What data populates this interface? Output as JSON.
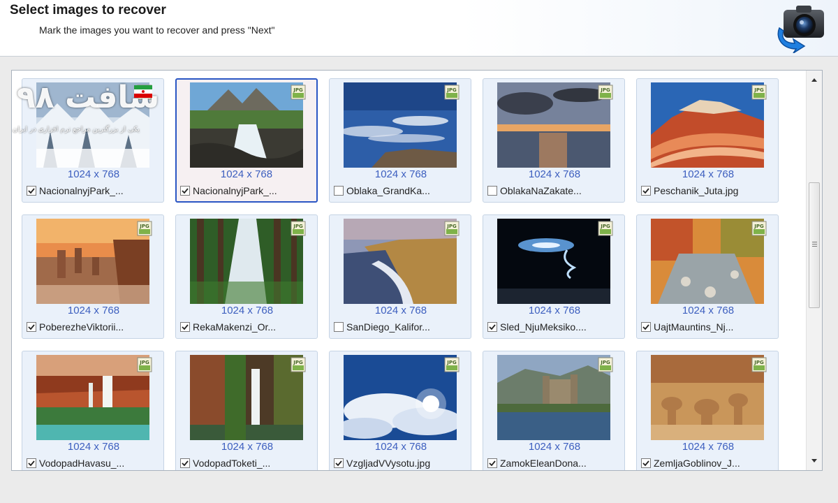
{
  "header": {
    "title": "Select images to recover",
    "subtitle": "Mark the images you want to recover and press \"Next\""
  },
  "watermark": {
    "text": "سافت ۹۸",
    "subtext": "یکی از بزرگترین مراجع نرم افزاری در ایران"
  },
  "icons": {
    "camera": "camera-recover-icon",
    "badge": "jpg-badge-icon",
    "checkbox": "checkbox-icon"
  },
  "colors": {
    "selection_border": "#2a56c4",
    "dims_text": "#3d5fbf",
    "tile_bg": "#eaf1fa"
  },
  "gallery": {
    "items": [
      {
        "dims": "1024 x 768",
        "name": "NacionalnyjPark_...",
        "checked": true,
        "selected": false,
        "scene": "snow"
      },
      {
        "dims": "1024 x 768",
        "name": "NacionalnyjPark_...",
        "checked": true,
        "selected": true,
        "scene": "waterfall-mountain"
      },
      {
        "dims": "1024 x 768",
        "name": "Oblaka_GrandKa...",
        "checked": false,
        "selected": false,
        "scene": "sky-clouds"
      },
      {
        "dims": "1024 x 768",
        "name": "OblakaNaZakate...",
        "checked": false,
        "selected": false,
        "scene": "sunset-sea"
      },
      {
        "dims": "1024 x 768",
        "name": "Peschanik_Juta.jpg",
        "checked": true,
        "selected": false,
        "scene": "sandstone"
      },
      {
        "dims": "1024 x 768",
        "name": "PoberezheViktorii...",
        "checked": true,
        "selected": false,
        "scene": "coast-sunset"
      },
      {
        "dims": "1024 x 768",
        "name": "RekaMakenzi_Or...",
        "checked": true,
        "selected": false,
        "scene": "forest-river"
      },
      {
        "dims": "1024 x 768",
        "name": "SanDiego_Kalifor...",
        "checked": false,
        "selected": false,
        "scene": "cliffs"
      },
      {
        "dims": "1024 x 768",
        "name": "Sled_NjuMeksiko....",
        "checked": true,
        "selected": false,
        "scene": "night-trail"
      },
      {
        "dims": "1024 x 768",
        "name": "UajtMauntins_Nj...",
        "checked": true,
        "selected": false,
        "scene": "autumn-stream"
      },
      {
        "dims": "1024 x 768",
        "name": "VodopadHavasu_...",
        "checked": true,
        "selected": false,
        "scene": "havasu-falls"
      },
      {
        "dims": "1024 x 768",
        "name": "VodopadToketi_...",
        "checked": true,
        "selected": false,
        "scene": "canyon-waterfall"
      },
      {
        "dims": "1024 x 768",
        "name": "VzgljadVVysotu.jpg",
        "checked": true,
        "selected": false,
        "scene": "sky-sun"
      },
      {
        "dims": "1024 x 768",
        "name": "ZamokEleanDona...",
        "checked": true,
        "selected": false,
        "scene": "castle"
      },
      {
        "dims": "1024 x 768",
        "name": "ZemljaGoblinov_J...",
        "checked": true,
        "selected": false,
        "scene": "goblins"
      }
    ]
  }
}
